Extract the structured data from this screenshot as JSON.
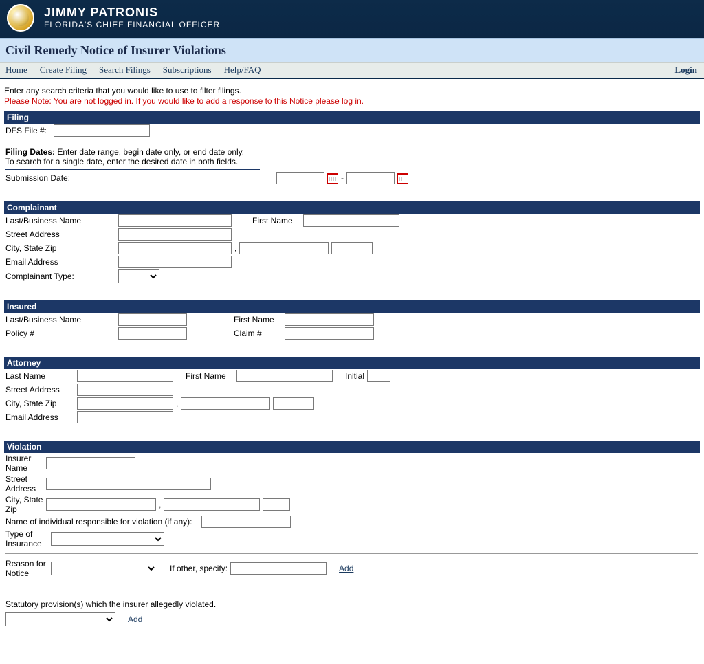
{
  "banner": {
    "name": "JIMMY PATRONIS",
    "subtitle": "FLORIDA'S CHIEF FINANCIAL OFFICER"
  },
  "page_title": "Civil Remedy Notice of Insurer Violations",
  "menu": {
    "home": "Home",
    "create_filing": "Create Filing",
    "search_filings": "Search Filings",
    "subscriptions": "Subscriptions",
    "help_faq": "Help/FAQ",
    "login": "Login"
  },
  "intro_text": "Enter any search criteria that you would like to use to filter filings.",
  "login_note": "Please Note: You are not logged in. If you would like to add a response to this Notice please log in.",
  "filing": {
    "header": "Filing",
    "dfs_file_label": "DFS File #:",
    "filing_dates_label": "Filing Dates:",
    "filing_dates_text": "Enter date range, begin date only, or end date only.",
    "single_date_text": "To search for a single date, enter the desired date in both fields.",
    "submission_date_label": "Submission Date:",
    "dash": "-"
  },
  "complainant": {
    "header": "Complainant",
    "last_business_name": "Last/Business Name",
    "first_name": "First Name",
    "street_address": "Street Address",
    "city_state_zip": "City, State Zip",
    "email_address": "Email Address",
    "complainant_type": "Complainant Type:",
    "comma": ","
  },
  "insured": {
    "header": "Insured",
    "last_business_name": "Last/Business Name",
    "first_name": "First Name",
    "policy_no": "Policy #",
    "claim_no": "Claim #"
  },
  "attorney": {
    "header": "Attorney",
    "last_name": "Last Name",
    "first_name": "First Name",
    "initial": "Initial",
    "street_address": "Street Address",
    "city_state_zip": "City, State Zip",
    "email_address": "Email Address",
    "comma": ","
  },
  "violation": {
    "header": "Violation",
    "insurer_name": "Insurer Name",
    "street_address": "Street Address",
    "city_state_zip": "City, State Zip",
    "responsible_name": "Name of individual responsible for violation (if any):",
    "type_of_insurance": "Type of Insurance",
    "reason_for_notice": "Reason for Notice",
    "if_other_specify": "If other, specify:",
    "add": "Add",
    "statutory_text": "Statutory provision(s) which the insurer allegedly violated.",
    "comma": ","
  }
}
